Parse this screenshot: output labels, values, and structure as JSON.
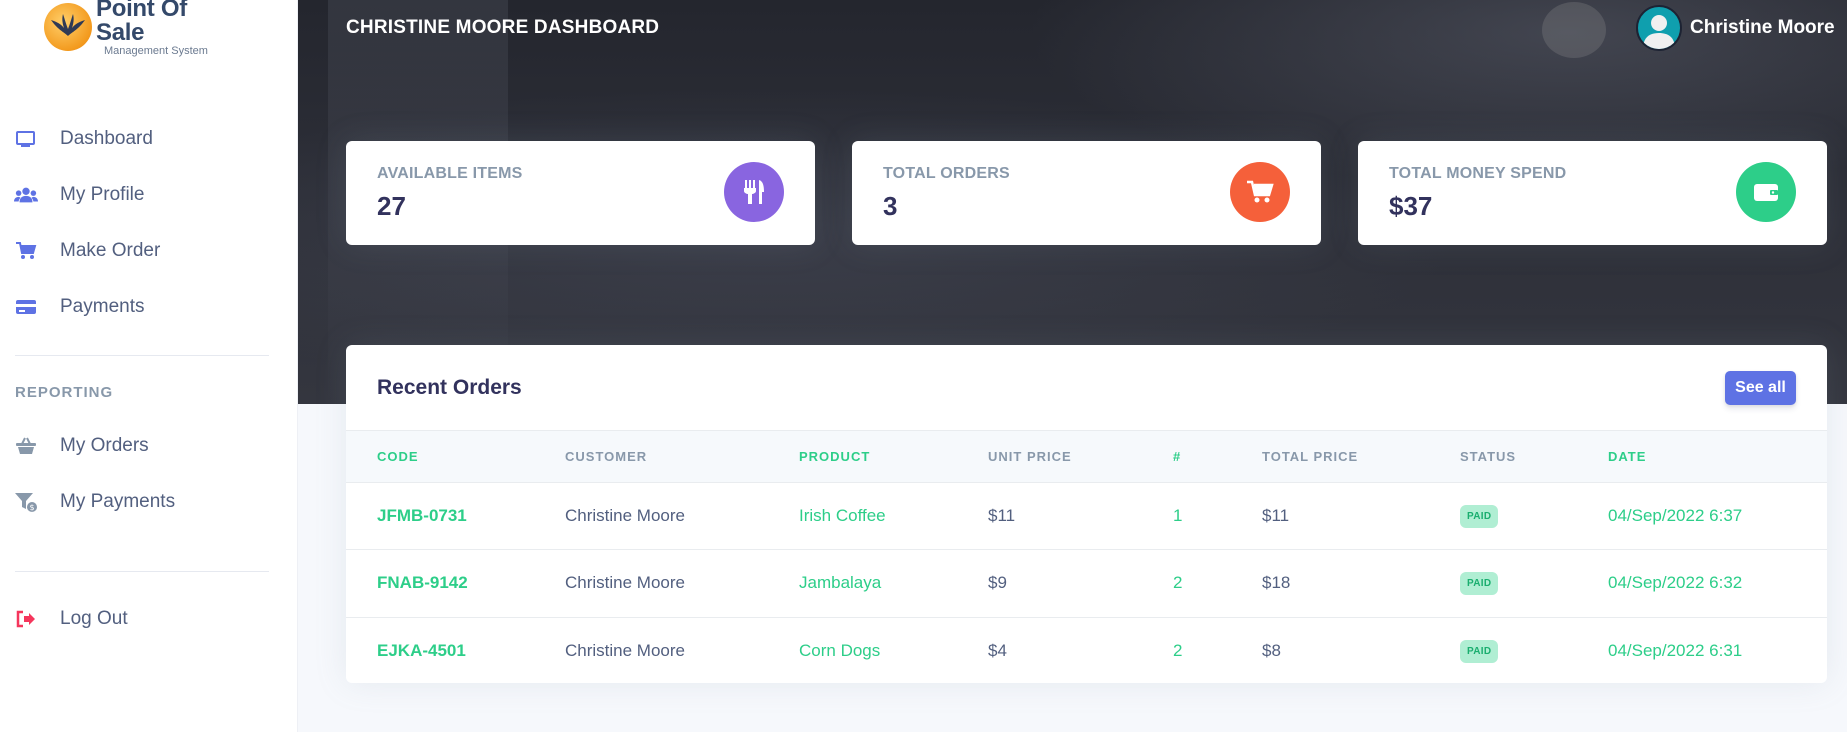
{
  "logo": {
    "title": "Point Of Sale",
    "subtitle": "Management System"
  },
  "sidebar": {
    "items": [
      {
        "label": "Dashboard",
        "icon": "monitor-icon"
      },
      {
        "label": "My Profile",
        "icon": "users-icon"
      },
      {
        "label": "Make Order",
        "icon": "cart-icon"
      },
      {
        "label": "Payments",
        "icon": "credit-card-icon"
      }
    ],
    "reporting_heading": "REPORTING",
    "reporting_items": [
      {
        "label": "My Orders",
        "icon": "basket-icon"
      },
      {
        "label": "My Payments",
        "icon": "funnel-dollar-icon"
      }
    ],
    "logout_label": "Log Out"
  },
  "header": {
    "title": "CHRISTINE MOORE DASHBOARD",
    "user_name": "Christine Moore"
  },
  "stats": [
    {
      "label": "AVAILABLE ITEMS",
      "value": "27",
      "icon": "utensils-icon",
      "color": "#8965e0"
    },
    {
      "label": "TOTAL ORDERS",
      "value": "3",
      "icon": "cart-icon",
      "color": "#f5603a"
    },
    {
      "label": "TOTAL MONEY SPEND",
      "value": "$37",
      "icon": "wallet-icon",
      "color": "#2dce89"
    }
  ],
  "orders": {
    "title": "Recent Orders",
    "see_all_label": "See all",
    "columns": [
      "CODE",
      "CUSTOMER",
      "PRODUCT",
      "UNIT PRICE",
      "#",
      "TOTAL PRICE",
      "STATUS",
      "DATE"
    ],
    "rows": [
      {
        "code": "JFMB-0731",
        "customer": "Christine Moore",
        "product": "Irish Coffee",
        "unit_price": "$11",
        "qty": "1",
        "total": "$11",
        "status": "PAID",
        "date": "04/Sep/2022 6:37"
      },
      {
        "code": "FNAB-9142",
        "customer": "Christine Moore",
        "product": "Jambalaya",
        "unit_price": "$9",
        "qty": "2",
        "total": "$18",
        "status": "PAID",
        "date": "04/Sep/2022 6:32"
      },
      {
        "code": "EJKA-4501",
        "customer": "Christine Moore",
        "product": "Corn Dogs",
        "unit_price": "$4",
        "qty": "2",
        "total": "$8",
        "status": "PAID",
        "date": "04/Sep/2022 6:31"
      }
    ]
  },
  "colors": {
    "primary": "#5e72e4",
    "success": "#2dce89",
    "danger": "#f5365c"
  }
}
